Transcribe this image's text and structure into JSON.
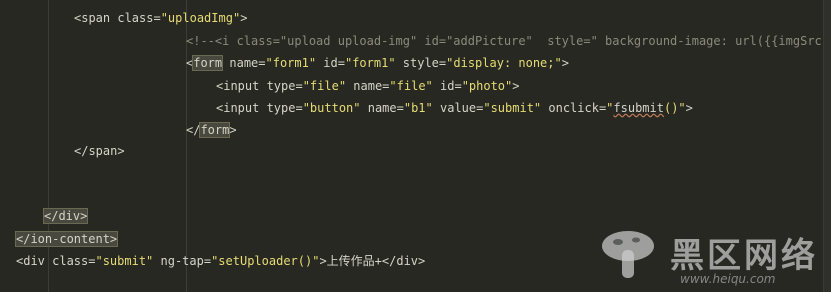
{
  "editor": {
    "lines": [
      {
        "indent": "",
        "tokens": [
          "<span class=",
          "\"uploadImg\"",
          ">"
        ]
      },
      {
        "tokens": [
          "<!--<i class=\"upload upload-img\" id=\"addPicture\"  style=\" background-image: url({{imgSrc || "
        ]
      },
      {
        "tokens": [
          "<",
          "form",
          " name=",
          "\"form1\"",
          " id=",
          "\"form1\"",
          " style=",
          "\"display: none;\"",
          ">"
        ]
      },
      {
        "tokens": [
          "<input type=",
          "\"file\"",
          " name=",
          "\"file\"",
          " id=",
          "\"photo\"",
          ">"
        ]
      },
      {
        "tokens": [
          "<input type=",
          "\"button\"",
          " name=",
          "\"b1\"",
          " value=",
          "\"submit\"",
          " onclick=",
          "\"",
          "fsubmit",
          "()\"",
          ">"
        ]
      },
      {
        "tokens": [
          "</",
          "form",
          ">"
        ]
      },
      {
        "tokens": [
          "</span>"
        ]
      },
      {
        "tokens": [
          "</div>"
        ]
      },
      {
        "tokens": [
          "</ion-content>"
        ]
      },
      {
        "tokens": [
          "<div class=",
          "\"submit\"",
          " ng-tap=",
          "\"setUploader()\"",
          ">上传作品+</div>"
        ]
      }
    ]
  },
  "watermark": {
    "cn": "黑区网络",
    "url": "www.heiqu.com"
  },
  "colors": {
    "background": "#272822",
    "string": "#e6db74",
    "comment": "#8a8a7c",
    "tag": "#d4d4c8"
  }
}
